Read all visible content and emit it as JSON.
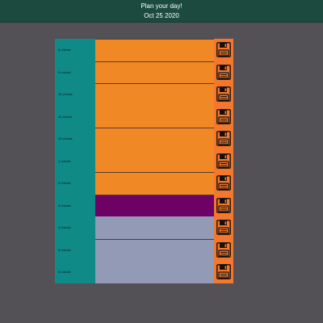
{
  "header": {
    "title": "Plan your day!",
    "date": "Oct 25 2020"
  },
  "hours": [
    {
      "label": "8 o'clock"
    },
    {
      "label": "9 o'clock"
    },
    {
      "label": "10 o'clock"
    },
    {
      "label": "11 o'clock"
    },
    {
      "label": "12 o'clock"
    },
    {
      "label": "1 o'clock"
    },
    {
      "label": "2 o'clock"
    },
    {
      "label": "3 o'clock"
    },
    {
      "label": "4 o'clock"
    },
    {
      "label": "5 o'clock"
    },
    {
      "label": "6 o'clock"
    }
  ],
  "icons": {
    "save": "floppy-disk-icon"
  },
  "colors": {
    "past": "#929ab5",
    "present": "#6e0166",
    "future": "#f18826",
    "hour": "#0f8a87",
    "save": "#f3772c",
    "header": "#1c4a3f",
    "background": "#535155"
  }
}
